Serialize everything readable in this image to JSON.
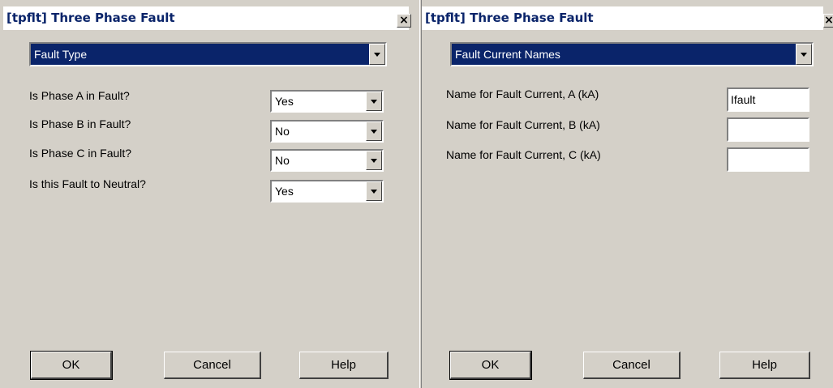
{
  "left_dialog": {
    "title": "[tpflt] Three Phase Fault",
    "close_glyph": "×",
    "page_select": "Fault Type",
    "fields": [
      {
        "label": "Is Phase A in Fault?",
        "value": "Yes"
      },
      {
        "label": "Is Phase B in Fault?",
        "value": "No"
      },
      {
        "label": "Is Phase C in Fault?",
        "value": "No"
      },
      {
        "label": "Is this Fault to Neutral?",
        "value": "Yes"
      }
    ],
    "buttons": {
      "ok": "OK",
      "cancel": "Cancel",
      "help": "Help"
    }
  },
  "right_dialog": {
    "title": "[tpflt] Three Phase Fault",
    "close_glyph": "×",
    "page_select": "Fault Current Names",
    "fields": [
      {
        "label": "Name for Fault Current, A (kA)",
        "value": "Ifault"
      },
      {
        "label": "Name for Fault Current, B (kA)",
        "value": ""
      },
      {
        "label": "Name for Fault Current, C (kA)",
        "value": ""
      }
    ],
    "buttons": {
      "ok": "OK",
      "cancel": "Cancel",
      "help": "Help"
    }
  },
  "colors": {
    "window_bg": "#d4d0c8",
    "title_text": "#0a246a",
    "selection_bg": "#0a246a"
  },
  "icons": {
    "close": "close-icon",
    "dropdown": "chevron-down-icon"
  }
}
